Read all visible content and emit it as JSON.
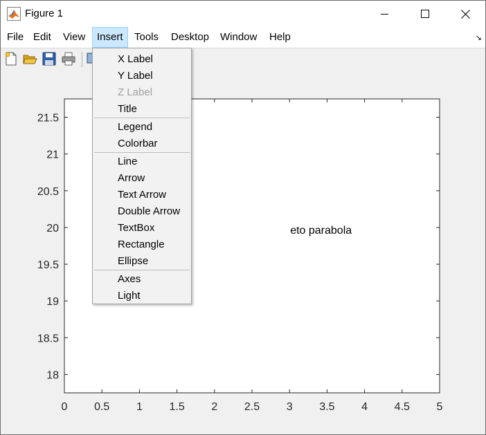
{
  "window": {
    "title": "Figure 1",
    "minimize_icon": "minimize-icon",
    "maximize_icon": "maximize-icon",
    "close_icon": "close-icon"
  },
  "menubar": {
    "items": [
      "File",
      "Edit",
      "View",
      "Insert",
      "Tools",
      "Desktop",
      "Window",
      "Help"
    ],
    "active": "Insert"
  },
  "toolbar": {
    "icons": [
      "new-figure-icon",
      "open-file-icon",
      "save-icon",
      "print-icon"
    ]
  },
  "insert_menu": {
    "groups": [
      [
        "X Label",
        "Y Label",
        "Z Label",
        "Title"
      ],
      [
        "Legend",
        "Colorbar"
      ],
      [
        "Line",
        "Arrow",
        "Text Arrow",
        "Double Arrow",
        "TextBox",
        "Rectangle",
        "Ellipse"
      ],
      [
        "Axes",
        "Light"
      ]
    ],
    "disabled": [
      "Z Label"
    ]
  },
  "chart_data": {
    "type": "line",
    "series": [],
    "xlim": [
      0,
      5
    ],
    "ylim": [
      17.75,
      21.75
    ],
    "xticks": [
      "0",
      "0.5",
      "1",
      "1.5",
      "2",
      "2.5",
      "3",
      "3.5",
      "4",
      "4.5",
      "5"
    ],
    "yticks": [
      "18",
      "18.5",
      "19",
      "19.5",
      "20",
      "20.5",
      "21",
      "21.5"
    ],
    "annotation": {
      "text": "eto parabola",
      "x": 3.0,
      "y": 19.97
    },
    "grid": false,
    "title": "",
    "xlabel": "",
    "ylabel": ""
  }
}
